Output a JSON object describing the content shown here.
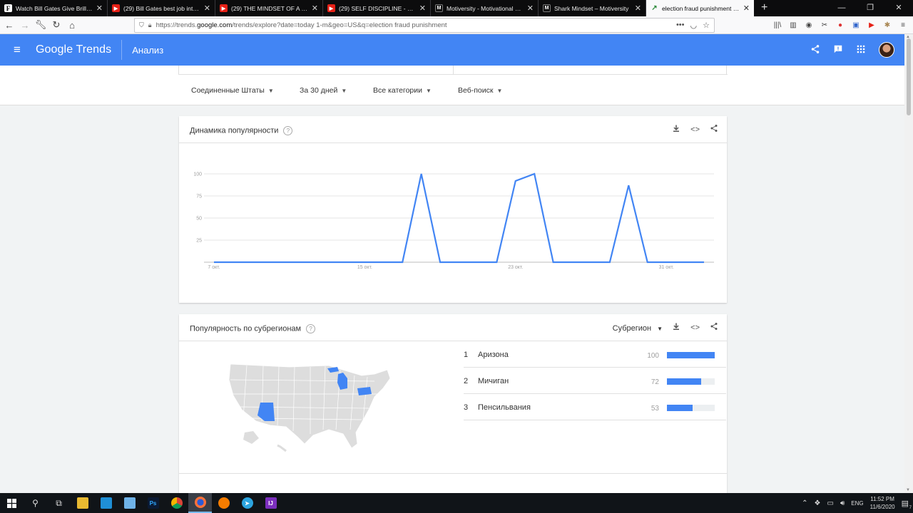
{
  "browser": {
    "tabs": [
      {
        "title": "Watch Bill Gates Give Brilliant",
        "favicon": "f-icon",
        "letter": "F",
        "kind": "f"
      },
      {
        "title": "(29) Bill Gates best job intervie",
        "favicon": "youtube-icon",
        "letter": "▶",
        "kind": "yt"
      },
      {
        "title": "(29) THE MINDSET OF A WINNI",
        "favicon": "youtube-icon",
        "letter": "▶",
        "kind": "yt"
      },
      {
        "title": "(29) SELF DISCIPLINE - Best Mo",
        "favicon": "youtube-icon",
        "letter": "▶",
        "kind": "yt"
      },
      {
        "title": "Motiversity - Motivational Vide",
        "favicon": "motiversity-icon",
        "letter": "M",
        "kind": "m"
      },
      {
        "title": "Shark Mindset – Motiversity",
        "favicon": "motiversity-icon",
        "letter": "M",
        "kind": "m"
      },
      {
        "title": "election fraud punishment - Ан",
        "favicon": "google-trends-icon",
        "letter": "↗",
        "kind": "gt"
      }
    ],
    "active_tab": 6,
    "url_prefix": "https://trends.",
    "url_domain": "google.com",
    "url_rest": "/trends/explore?date=today 1-m&geo=US&q=election fraud punishment"
  },
  "header": {
    "logo": "Google Trends",
    "title": "Анализ"
  },
  "filters": [
    {
      "label": "Соединенные Штаты"
    },
    {
      "label": "За 30 дней"
    },
    {
      "label": "Все категории"
    },
    {
      "label": "Веб-поиск"
    }
  ],
  "interest_over_time": {
    "title": "Динамика популярности",
    "help": "?"
  },
  "chart_data": {
    "type": "line",
    "title": "Динамика популярности",
    "xlabel": "",
    "ylabel": "",
    "ylim": [
      0,
      100
    ],
    "y_ticks": [
      100,
      75,
      50,
      25
    ],
    "x_ticks": [
      "7 окт.",
      "15 окт.",
      "23 окт.",
      "31 окт."
    ],
    "x_tick_index": [
      0,
      8,
      16,
      24
    ],
    "x_count": 27,
    "series": [
      {
        "values": [
          0,
          0,
          0,
          0,
          0,
          0,
          0,
          0,
          0,
          0,
          0,
          100,
          0,
          0,
          0,
          0,
          92,
          100,
          0,
          0,
          0,
          0,
          87,
          0,
          0,
          0,
          0
        ],
        "color": "#4285f4"
      }
    ]
  },
  "subregion": {
    "title": "Популярность по субрегионам",
    "help": "?",
    "selector": "Субрегион",
    "rows": [
      {
        "rank": "1",
        "name": "Аризона",
        "value": "100",
        "fraction": 1.0
      },
      {
        "rank": "2",
        "name": "Мичиган",
        "value": "72",
        "fraction": 0.72
      },
      {
        "rank": "3",
        "name": "Пенсильвания",
        "value": "53",
        "fraction": 0.53
      }
    ],
    "map_highlight_color": "#4285f4",
    "map_base_color": "#dddddd"
  },
  "taskbar": {
    "lang": "ENG",
    "time": "11:52 PM",
    "date": "11/6/2020",
    "notifications": "7"
  }
}
